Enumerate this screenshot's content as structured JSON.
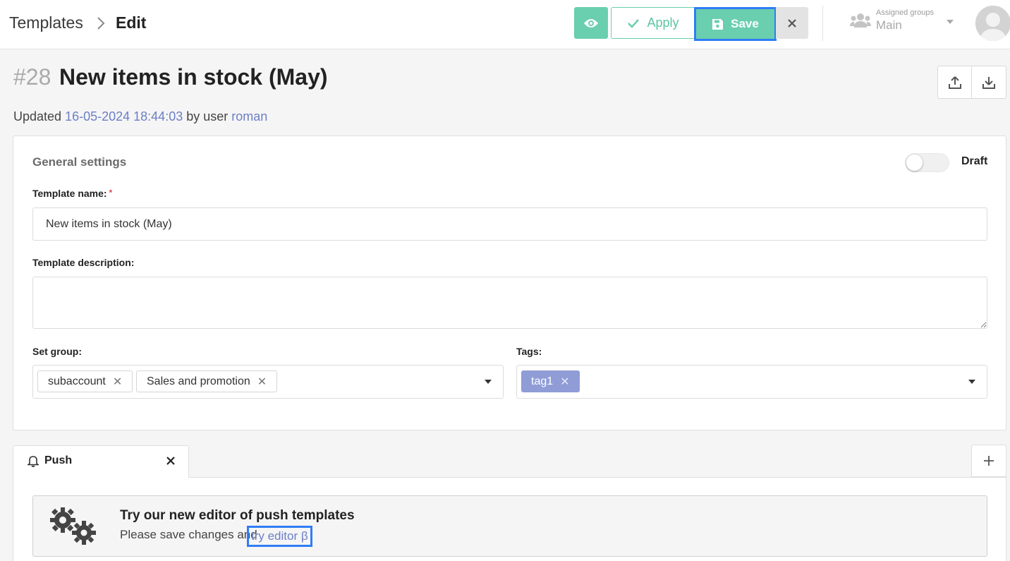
{
  "header": {
    "breadcrumb_root": "Templates",
    "breadcrumb_current": "Edit",
    "apply_label": "Apply",
    "save_label": "Save",
    "assigned_groups_caption": "Assigned groups",
    "assigned_groups_value": "Main"
  },
  "template": {
    "id": "#28",
    "title": "New items in stock (May)",
    "updated_prefix": "Updated",
    "updated_date": "16-05-2024 18:44:03",
    "updated_by_text": "by user",
    "updated_user": "roman"
  },
  "general_settings": {
    "title": "General settings",
    "draft_label": "Draft",
    "draft_enabled": false,
    "name_label": "Template name:",
    "required_mark": "*",
    "name_value": "New items in stock (May)",
    "description_label": "Template description:",
    "description_value": "",
    "set_group_label": "Set group:",
    "groups": [
      "subaccount",
      "Sales and promotion"
    ],
    "tags_label": "Tags:",
    "tags": [
      "tag1"
    ]
  },
  "tabs": {
    "push_label": "Push"
  },
  "promo": {
    "title": "Try our new editor of push templates",
    "text": "Please save changes and",
    "link": "try editor β"
  },
  "colors": {
    "accent_green": "#6acfae",
    "link_blue": "#6c7fc6",
    "highlight_blue": "#2f7df6",
    "tag_purple": "#8f9cd6"
  }
}
